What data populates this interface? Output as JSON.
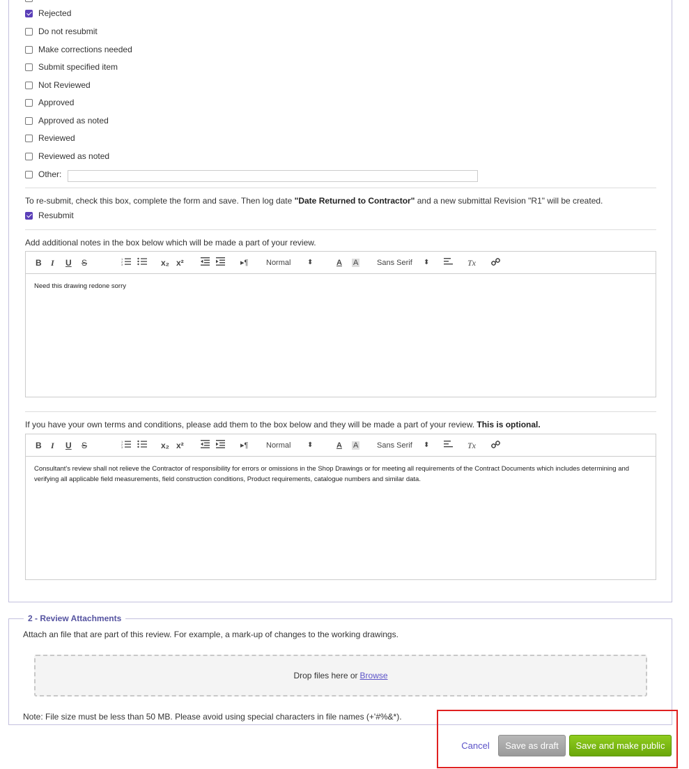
{
  "review_options": [
    {
      "label": "Rejected",
      "checked": true
    },
    {
      "label": "Do not resubmit",
      "checked": false
    },
    {
      "label": "Make corrections needed",
      "checked": false
    },
    {
      "label": "Submit specified item",
      "checked": false
    },
    {
      "label": "Not Reviewed",
      "checked": false
    },
    {
      "label": "Approved",
      "checked": false
    },
    {
      "label": "Approved as noted",
      "checked": false
    },
    {
      "label": "Reviewed",
      "checked": false
    },
    {
      "label": "Reviewed as noted",
      "checked": false
    },
    {
      "label": "Other:",
      "checked": false
    }
  ],
  "other_value": "",
  "resubmit": {
    "instructions_pre": "To re-submit, check this box, complete the form and save. Then log date ",
    "instructions_bold": "\"Date Returned to Contractor\"",
    "instructions_post": " and a new submittal Revision \"R1\" will be created.",
    "label": "Resubmit",
    "checked": true
  },
  "notes": {
    "intro": "Add additional notes in the box below which will be made a part of your review.",
    "content": "Need this drawing redone sorry"
  },
  "terms": {
    "intro": "If you have your own terms and conditions, please add them to the box below and they will be made a part of your review. ",
    "intro_bold": "This is optional.",
    "content": "Consultant's review shall not relieve the Contractor of responsibility for errors or omissions in the Shop Drawings or for meeting all requirements of the Contract Documents which includes determining and verifying all applicable field measurements, field construction conditions, Product requirements, catalogue numbers and similar data."
  },
  "toolbar": {
    "bold": "B",
    "italic": "I",
    "underline": "U",
    "strike": "S",
    "subscript": "x₂",
    "superscript": "x²",
    "direction": "▸¶",
    "header_select": "Normal",
    "font_select": "Sans Serif",
    "select_arrow": "⬍",
    "color": "A",
    "background": "A",
    "clean": "Tx"
  },
  "attachments": {
    "legend": "2 - Review Attachments",
    "description": "Attach an file that are part of this review. For example, a mark-up of changes to the working drawings.",
    "drop_text": "Drop files here or",
    "browse_label": "Browse",
    "note": "Note: File size must be less than 50 MB. Please avoid using special characters in file names (+'#%&*)."
  },
  "actions": {
    "cancel": "Cancel",
    "save_draft": "Save as draft",
    "save_public": "Save and make public"
  },
  "colors": {
    "accent": "#5b3fb8",
    "primary_button": "#7ab713",
    "secondary_button": "#a8a8a8",
    "highlight_border": "#e02020"
  }
}
